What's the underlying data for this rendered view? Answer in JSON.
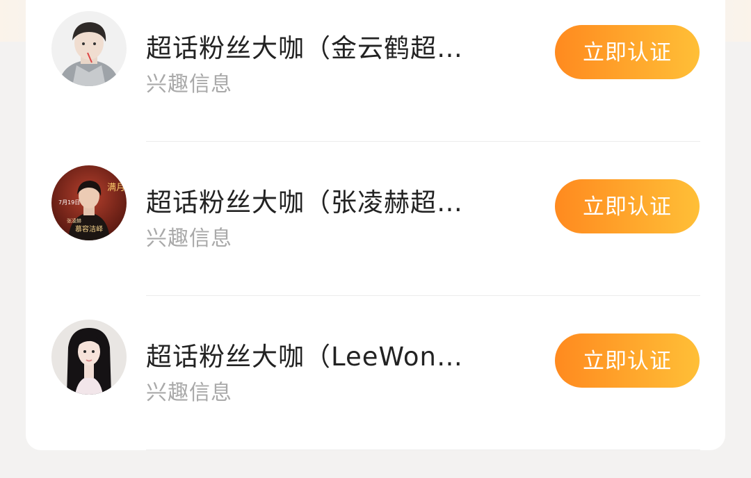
{
  "items": [
    {
      "title": "超话粉丝大咖（金云鹤超…",
      "subtitle": "兴趣信息",
      "button_label": "立即认证",
      "avatar_icon": "avatar-person-gray-hoodie"
    },
    {
      "title": "超话粉丝大咖（张凌赫超…",
      "subtitle": "兴趣信息",
      "button_label": "立即认证",
      "avatar_icon": "avatar-drama-poster",
      "avatar_text": {
        "date": "7月19日",
        "name": "张凌赫",
        "role": "慕容洁峄",
        "side": "满月"
      }
    },
    {
      "title": "超话粉丝大咖（LeeWon…",
      "subtitle": "兴趣信息",
      "button_label": "立即认证",
      "avatar_icon": "avatar-person-long-dark-hair"
    }
  ],
  "colors": {
    "button_start": "#ff8a1f",
    "button_end": "#ffbf37",
    "title": "#222222",
    "subtitle": "#a9a9a9",
    "background": "#f3f2f1"
  }
}
